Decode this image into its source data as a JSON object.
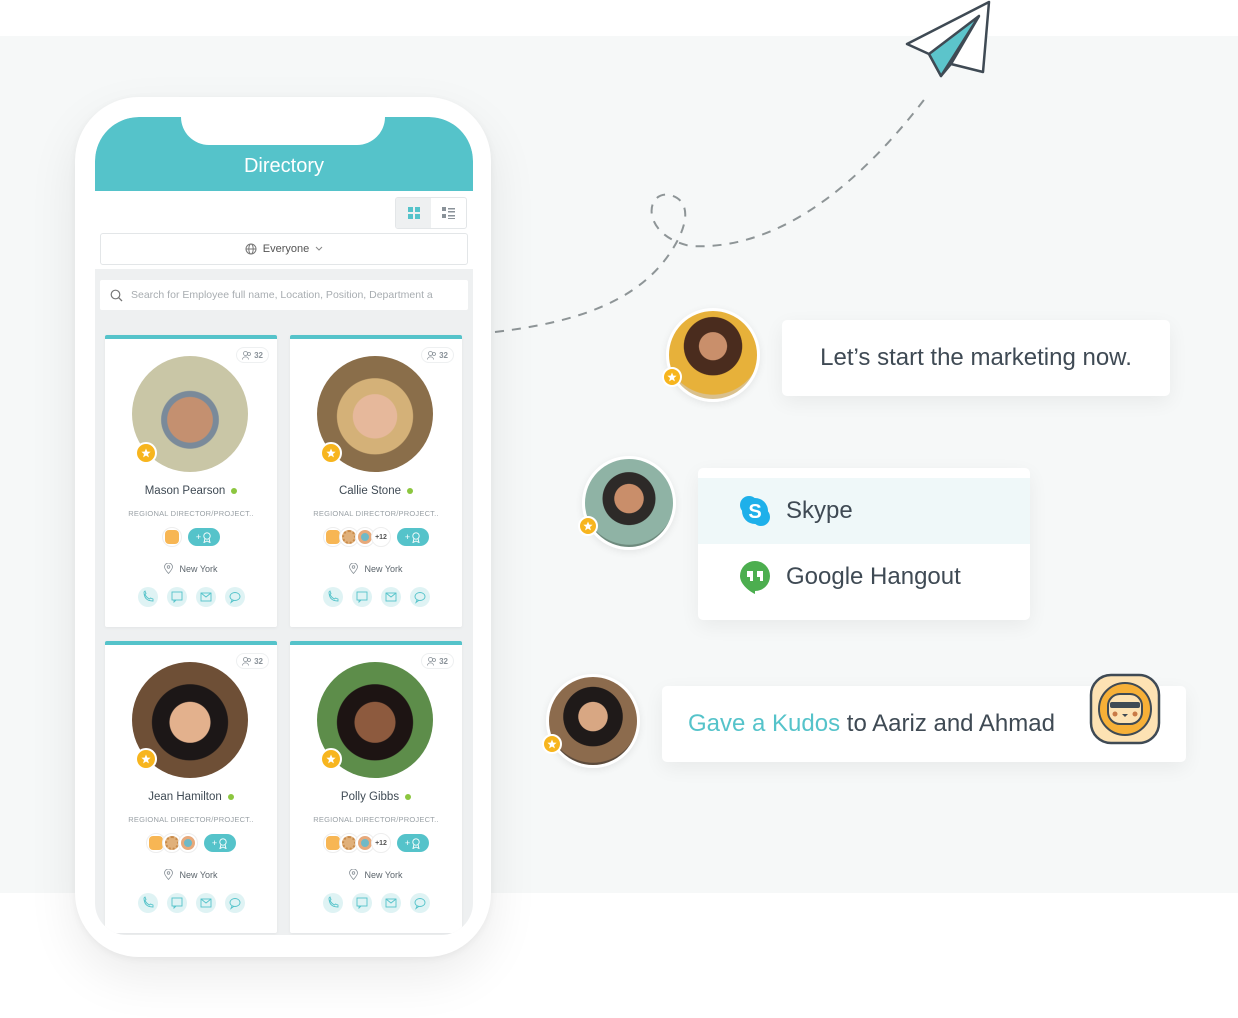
{
  "colors": {
    "accent": "#55c3ca",
    "star": "#f7b51e",
    "online": "#8cc63f",
    "skype": "#1eb0ea",
    "hangout": "#4cae4f",
    "text": "#3f4a54"
  },
  "app": {
    "title": "Directory",
    "view_toggle": [
      {
        "name": "grid-view",
        "icon": "grid-icon",
        "active": true
      },
      {
        "name": "list-view",
        "icon": "list-icon",
        "active": false
      }
    ],
    "audience": {
      "icon": "globe-icon",
      "label": "Everyone",
      "caret": "chevron-down-icon"
    },
    "search": {
      "icon": "search-icon",
      "placeholder": "Search for Employee full name, Location, Position, Department a"
    }
  },
  "employees": [
    {
      "name": "Mason Pearson",
      "role": "REGIONAL DIRECTOR/PROJECT..",
      "location": "New York",
      "count": "32",
      "online": true,
      "kudos": [
        "sun"
      ],
      "more": "",
      "give_label": "+"
    },
    {
      "name": "Callie Stone",
      "role": "REGIONAL DIRECTOR/PROJECT..",
      "location": "New York",
      "count": "32",
      "online": true,
      "kudos": [
        "sun",
        "lion",
        "ring"
      ],
      "more": "+12",
      "give_label": "+"
    },
    {
      "name": "Jean Hamilton",
      "role": "REGIONAL DIRECTOR/PROJECT..",
      "location": "New York",
      "count": "32",
      "online": true,
      "kudos": [
        "sun",
        "lion",
        "ring"
      ],
      "more": "",
      "give_label": "+"
    },
    {
      "name": "Polly Gibbs",
      "role": "REGIONAL DIRECTOR/PROJECT..",
      "location": "New York",
      "count": "32",
      "online": true,
      "kudos": [
        "sun",
        "lion",
        "ring"
      ],
      "more": "+12",
      "give_label": "+"
    }
  ],
  "card_actions": [
    "phone-icon",
    "sms-icon",
    "email-icon",
    "chat-icon"
  ],
  "feed": {
    "message": "Let’s start the marketing now.",
    "contact_options": [
      {
        "label": "Skype",
        "icon": "skype-icon",
        "highlighted": true
      },
      {
        "label": "Google Hangout",
        "icon": "google-hangout-icon",
        "highlighted": false
      }
    ],
    "kudos": {
      "action": "Gave a Kudos",
      "rest": " to Aariz and Ahmad",
      "badge_icon": "sun-kudos-icon"
    }
  }
}
